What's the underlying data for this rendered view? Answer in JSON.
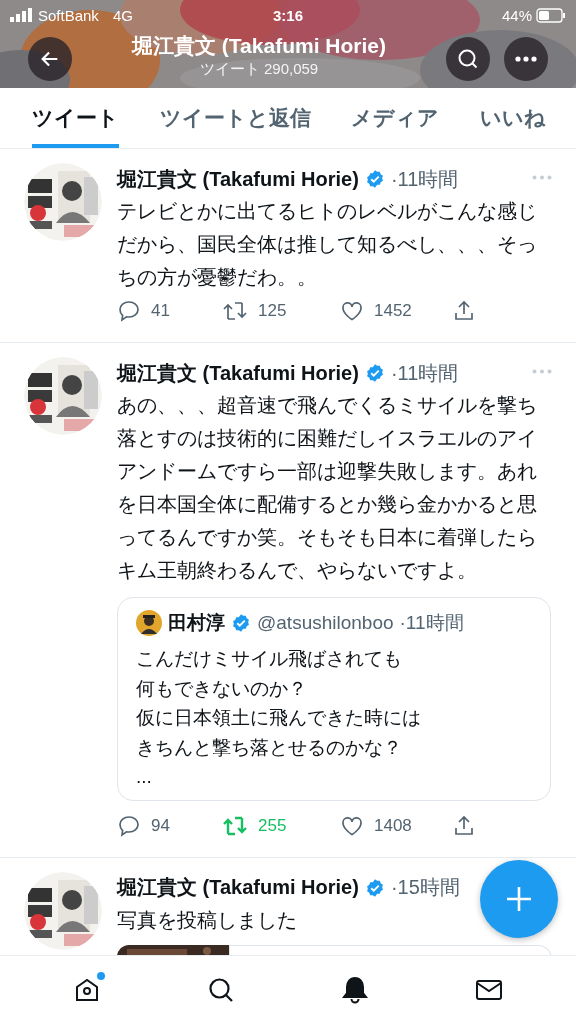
{
  "status_bar": {
    "carrier": "SoftBank",
    "network": "4G",
    "time": "3:16",
    "battery": "44%"
  },
  "header": {
    "title": "堀江貴文 (Takafumi Horie)",
    "subtitle": "ツイート 290,059"
  },
  "tabs": [
    {
      "label": "ツイート",
      "selected": true
    },
    {
      "label": "ツイートと返信",
      "selected": false
    },
    {
      "label": "メディア",
      "selected": false
    },
    {
      "label": "いいね",
      "selected": false
    }
  ],
  "tweets": [
    {
      "author": "堀江貴文 (Takafumi Horie)",
      "verified": true,
      "time": "·11時間",
      "text": "テレビとかに出てるヒトのレベルがこんな感じだから、国民全体は推して知るべし、、、そっちの方が憂鬱だわ。。",
      "actions": {
        "replies": "41",
        "retweets": "125",
        "likes": "1452",
        "retweeted": false
      }
    },
    {
      "author": "堀江貴文 (Takafumi Horie)",
      "verified": true,
      "time": "·11時間",
      "text": "あの、、、超音速で飛んでくるミサイルを撃ち落とすのは技術的に困難だしイスラエルのアイアンドームですら一部は迎撃失敗します。あれを日本国全体に配備するとか幾ら金かかると思ってるんですか笑。そもそも日本に着弾したらキム王朝終わるんで、やらないですよ。",
      "quote": {
        "author": "田村淳",
        "verified": true,
        "handle": "@atsushilonboo",
        "time": "·11時間",
        "lines": [
          "こんだけミサイル飛ばされても",
          "何もできないのか？",
          "仮に日本領土に飛んできた時には",
          "きちんと撃ち落とせるのかな？",
          "..."
        ]
      },
      "actions": {
        "replies": "94",
        "retweets": "255",
        "likes": "1408",
        "retweeted": true
      }
    },
    {
      "author": "堀江貴文 (Takafumi Horie)",
      "verified": true,
      "time": "·15時間",
      "text": "写真を投稿しました"
    }
  ],
  "bottom_nav": [
    {
      "kind": "home",
      "badge": true
    },
    {
      "kind": "search",
      "badge": false
    },
    {
      "kind": "bell",
      "badge": false
    },
    {
      "kind": "mail",
      "badge": false
    }
  ]
}
